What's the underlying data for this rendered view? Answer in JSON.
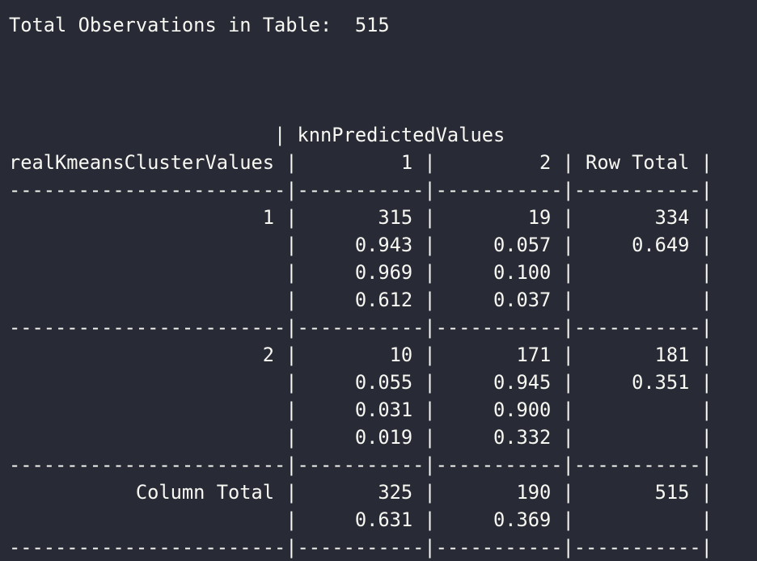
{
  "terminal": {
    "lines": [
      "Total Observations in Table:  515",
      "",
      "",
      "",
      "                       | knnPredictedValues",
      "realKmeansClusterValues |         1 |         2 | Row Total |",
      "------------------------|-----------|-----------|-----------|",
      "                      1 |       315 |        19 |       334 |",
      "                        |     0.943 |     0.057 |     0.649 |",
      "                        |     0.969 |     0.100 |           |",
      "                        |     0.612 |     0.037 |           |",
      "------------------------|-----------|-----------|-----------|",
      "                      2 |        10 |       171 |       181 |",
      "                        |     0.055 |     0.945 |     0.351 |",
      "                        |     0.031 |     0.900 |           |",
      "                        |     0.019 |     0.332 |           |",
      "------------------------|-----------|-----------|-----------|",
      "           Column Total |       325 |       190 |       515 |",
      "                        |     0.631 |     0.369 |           |",
      "------------------------|-----------|-----------|-----------|"
    ]
  }
}
